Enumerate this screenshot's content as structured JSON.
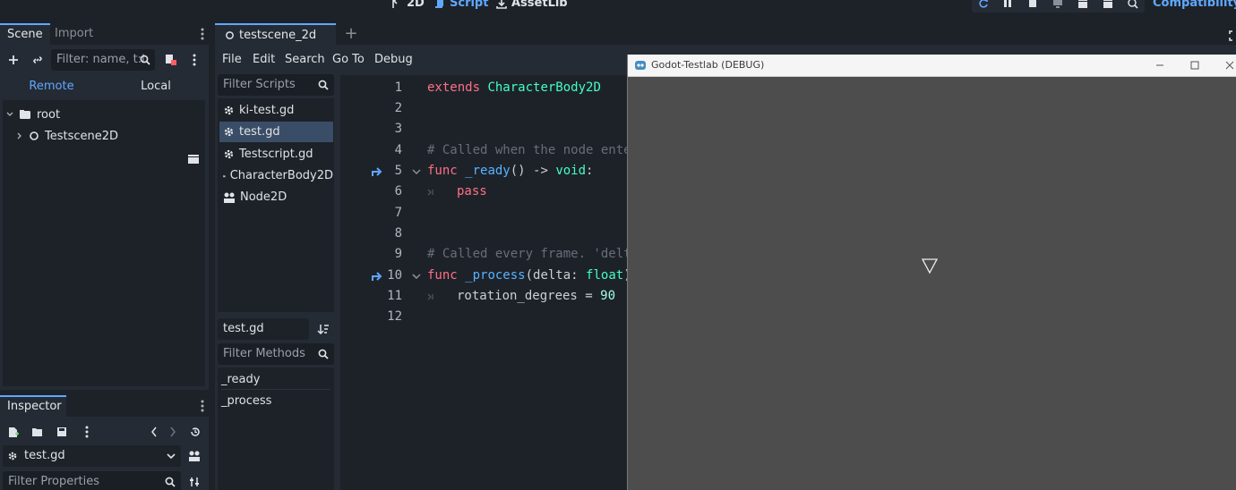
{
  "workspaces": {
    "view2d": "2D",
    "script": "Script",
    "assetlib": "AssetLib"
  },
  "renderer": "Compatibility",
  "scene_dock": {
    "tabs": [
      "Scene",
      "Import"
    ],
    "filter_placeholder": "Filter: name, t:t",
    "remote_label": "Remote",
    "local_label": "Local",
    "tree": [
      {
        "label": "root",
        "icon": "folder-icon"
      },
      {
        "label": "Testscene2D",
        "icon": "node-circle-icon"
      }
    ]
  },
  "inspector": {
    "tab": "Inspector",
    "resource": "test.gd",
    "filter_placeholder": "Filter Properties"
  },
  "editor_tab": {
    "label": "testscene_2d",
    "add": "+"
  },
  "script_menu": [
    "File",
    "Edit",
    "Search",
    "Go To",
    "Debug"
  ],
  "script_list": {
    "filter_placeholder": "Filter Scripts",
    "items": [
      {
        "label": "ki-test.gd",
        "icon": "gear-icon"
      },
      {
        "label": "test.gd",
        "icon": "gear-icon",
        "selected": true
      },
      {
        "label": "Testscript.gd",
        "icon": "gear-icon"
      },
      {
        "label": "CharacterBody2D",
        "icon": "doc-icon"
      },
      {
        "label": "Node2D",
        "icon": "doc-icon"
      }
    ],
    "current": "test.gd",
    "methods_placeholder": "Filter Methods",
    "methods": [
      "_ready",
      "_process"
    ]
  },
  "code": {
    "line_numbers": [
      "1",
      "2",
      "3",
      "4",
      "5",
      "6",
      "7",
      "8",
      "9",
      "10",
      "11",
      "12"
    ],
    "l1_kw": "extends",
    "l1_type": "CharacterBody2D",
    "l4_comment": "# Called when the node ente",
    "l5_kw": "func",
    "l5_fn": "_ready",
    "l5_rest": "() -> ",
    "l5_type": "void",
    "l5_end": ":",
    "l6_kw": "pass",
    "l9_comment": "# Called every frame. 'delt",
    "l10_kw": "func",
    "l10_fn": "_process",
    "l10_rest": "(delta: ",
    "l10_type": "float",
    "l10_end": ")",
    "l11_var": "rotation_degrees = ",
    "l11_num": "90"
  },
  "debug_window": {
    "title": "Godot-Testlab (DEBUG)"
  }
}
